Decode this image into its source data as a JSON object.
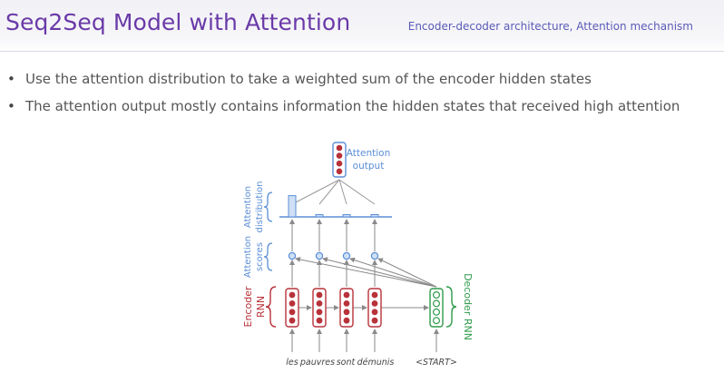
{
  "header": {
    "title": "Seq2Seq Model with Attention",
    "subtitle": "Encoder-decoder architecture, Attention mechanism"
  },
  "bullets": [
    "Use the attention distribution to take a weighted sum of the encoder hidden states",
    "The attention output mostly contains information the hidden states that received high attention"
  ],
  "diagram": {
    "output_label_line1": "Attention",
    "output_label_line2": "output",
    "dist_label_line1": "Attention",
    "dist_label_line2": "distribution",
    "scores_label_line1": "Attention",
    "scores_label_line2": "scores",
    "encoder_label_line1": "Encoder",
    "encoder_label_line2": "RNN",
    "decoder_label": "Decoder RNN",
    "words": [
      "les",
      "pauvres",
      "sont",
      "démunis",
      "<START>"
    ],
    "attention_weights": [
      0.9,
      0.04,
      0.03,
      0.03
    ],
    "colors": {
      "encoder": "#b8323a",
      "decoder": "#2e9a4a",
      "attention": "#5b8fd6",
      "neuron_encoder": "#b8323a",
      "neuron_decoder": "#5fb86f"
    }
  }
}
